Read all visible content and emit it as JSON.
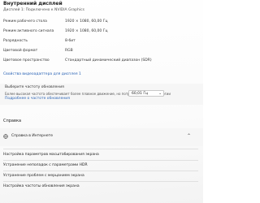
{
  "display_info": {
    "title": "Внутренний дисплей",
    "subtitle": "Дисплей 1: Подключено к NVIDIA Graphics",
    "rows": [
      {
        "label": "Режим рабочего стола",
        "value": "1920 × 1080, 60,00 Гц"
      },
      {
        "label": "Режим активного сигнала",
        "value": "1920 × 1080, 60,00 Гц"
      },
      {
        "label": "Разрядность",
        "value": "8-бит"
      },
      {
        "label": "Цветовой формат",
        "value": "RGB"
      },
      {
        "label": "Цветовое пространство",
        "value": "Стандартный динамический диапазон (SDR)"
      }
    ],
    "adapter_link": "Свойства видеоадаптера для дисплея 1"
  },
  "refresh_rate": {
    "title": "Выберите частоту обновления",
    "description": "Более высокая частота обеспечивает более плавное движение, но потребляет больше энергии",
    "link": "Подробнее о частоте обновления",
    "selected": "60,01 Гц"
  },
  "help": {
    "section_label": "Справка",
    "expander_label": "Справка в Интернете",
    "links": [
      "Настройка параметров масштабирования экрана",
      "Устранение неполадок с параметрами HDR",
      "Устранение проблем с мерцанием экрана",
      "Настройка частоты обновления экрана"
    ]
  },
  "icons": {
    "globe": "globe-icon",
    "chevron_down": "chevron-down-icon",
    "chevron_up": "chevron-up-icon"
  },
  "colors": {
    "link": "#2a63b5",
    "card_background": "#f6f6f6"
  }
}
